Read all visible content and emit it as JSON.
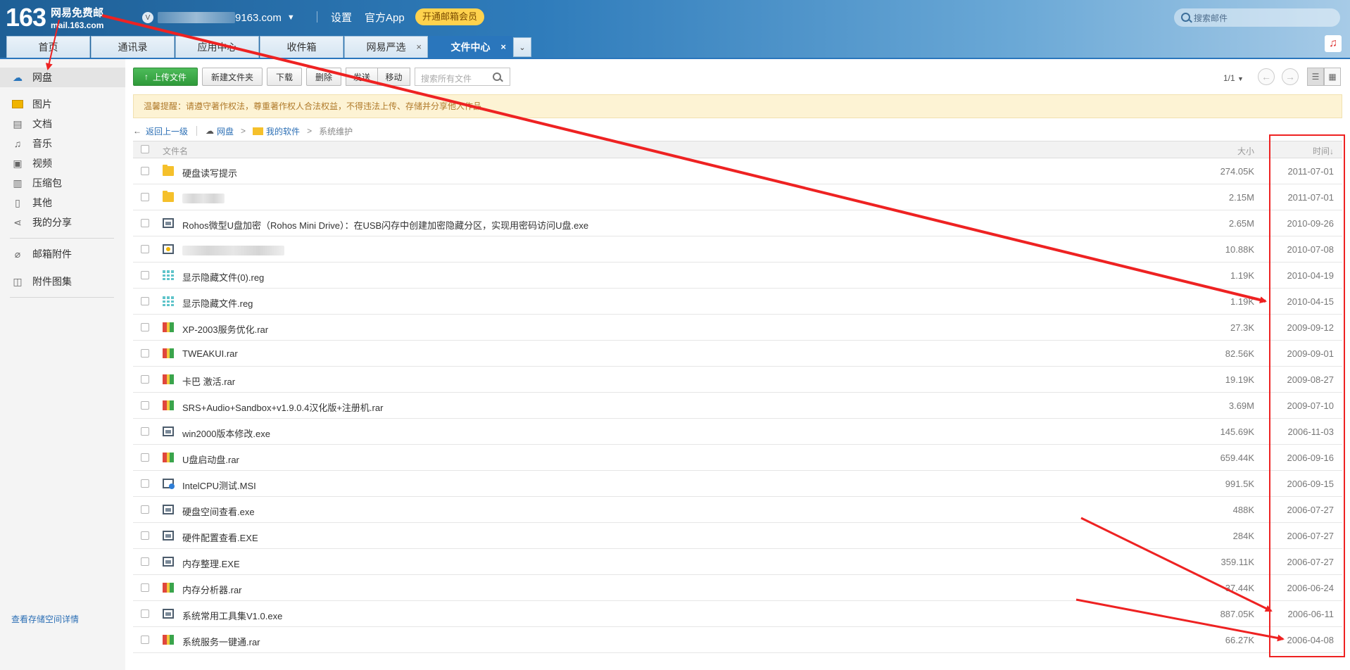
{
  "header": {
    "logo_number": "163",
    "logo_text": "网易免费邮",
    "logo_domain": "mail.163.com",
    "account_badge": "V",
    "account_visible": "9163.com",
    "settings": "设置",
    "official_app": "官方App",
    "vip_button": "开通邮箱会员",
    "search_placeholder": "搜索邮件"
  },
  "tabs": [
    {
      "label": "首页"
    },
    {
      "label": "通讯录"
    },
    {
      "label": "应用中心"
    },
    {
      "label": "收件箱"
    },
    {
      "label": "网易严选",
      "close": "×"
    },
    {
      "label": "文件中心",
      "close": "×",
      "active": true
    }
  ],
  "tabs_more_icon": "chevron-down-icon",
  "sidebar": {
    "top_item": {
      "label": "网盘",
      "icon": "cloud-drive-icon"
    },
    "items": [
      {
        "label": "图片",
        "icon": "image-icon"
      },
      {
        "label": "文档",
        "icon": "document-icon"
      },
      {
        "label": "音乐",
        "icon": "music-icon"
      },
      {
        "label": "视频",
        "icon": "video-icon"
      },
      {
        "label": "压缩包",
        "icon": "archive-icon"
      },
      {
        "label": "其他",
        "icon": "file-icon"
      },
      {
        "label": "我的分享",
        "icon": "share-icon"
      }
    ],
    "attachments": {
      "label": "邮箱附件",
      "icon": "paperclip-icon"
    },
    "gallery": {
      "label": "附件图集",
      "icon": "gallery-icon"
    },
    "storage_link": "查看存储空间详情"
  },
  "toolbar": {
    "upload": "上传文件",
    "new_folder": "新建文件夹",
    "download": "下载",
    "delete": "删除",
    "send": "发送",
    "move": "移动",
    "search_placeholder": "搜索所有文件",
    "pager": "1/1"
  },
  "notice": "温馨提醒：请遵守著作权法，尊重著作权人合法权益，不得违法上传、存储并分享他人作品",
  "breadcrumb": {
    "back": "返回上一级",
    "root": "网盘",
    "folder": "我的软件",
    "current": "系统维护",
    "separator": ">"
  },
  "table": {
    "col_name": "文件名",
    "col_size": "大小",
    "col_time": "时间",
    "sort_indicator": "↓",
    "rows": [
      {
        "name": "硬盘读写提示",
        "size": "274.05K",
        "time": "2011-07-01",
        "type": "folder"
      },
      {
        "name": "",
        "size": "2.15M",
        "time": "2011-07-01",
        "type": "folder",
        "blurred": true
      },
      {
        "name": "Rohos微型U盘加密（Rohos Mini Drive）：在USB闪存中创建加密隐藏分区，实现用密码访问U盘.exe",
        "size": "2.65M",
        "time": "2010-09-26",
        "type": "exe"
      },
      {
        "name": "",
        "size": "10.88K",
        "time": "2010-07-08",
        "type": "img",
        "blurred": true
      },
      {
        "name": "显示隐藏文件(0).reg",
        "size": "1.19K",
        "time": "2010-04-19",
        "type": "reg"
      },
      {
        "name": "显示隐藏文件.reg",
        "size": "1.19K",
        "time": "2010-04-15",
        "type": "reg"
      },
      {
        "name": "XP-2003服务优化.rar",
        "size": "27.3K",
        "time": "2009-09-12",
        "type": "rar"
      },
      {
        "name": "TWEAKUI.rar",
        "size": "82.56K",
        "time": "2009-09-01",
        "type": "rar"
      },
      {
        "name": "卡巴 激活.rar",
        "size": "19.19K",
        "time": "2009-08-27",
        "type": "rar"
      },
      {
        "name": "SRS+Audio+Sandbox+v1.9.0.4汉化版+注册机.rar",
        "size": "3.69M",
        "time": "2009-07-10",
        "type": "rar"
      },
      {
        "name": "win2000版本修改.exe",
        "size": "145.69K",
        "time": "2006-11-03",
        "type": "exe"
      },
      {
        "name": "U盘启动盘.rar",
        "size": "659.44K",
        "time": "2006-09-16",
        "type": "rar"
      },
      {
        "name": "IntelCPU测试.MSI",
        "size": "991.5K",
        "time": "2006-09-15",
        "type": "msi"
      },
      {
        "name": "硬盘空间查看.exe",
        "size": "488K",
        "time": "2006-07-27",
        "type": "exe"
      },
      {
        "name": "硬件配置查看.EXE",
        "size": "284K",
        "time": "2006-07-27",
        "type": "exe"
      },
      {
        "name": "内存整理.EXE",
        "size": "359.11K",
        "time": "2006-07-27",
        "type": "exe"
      },
      {
        "name": "内存分析器.rar",
        "size": "37.44K",
        "time": "2006-06-24",
        "type": "rar"
      },
      {
        "name": "系统常用工具集V1.0.exe",
        "size": "887.05K",
        "time": "2006-06-11",
        "type": "exe"
      },
      {
        "name": "系统服务一键通.rar",
        "size": "66.27K",
        "time": "2006-04-08",
        "type": "rar"
      }
    ]
  },
  "annotation_color": "#ee2222"
}
